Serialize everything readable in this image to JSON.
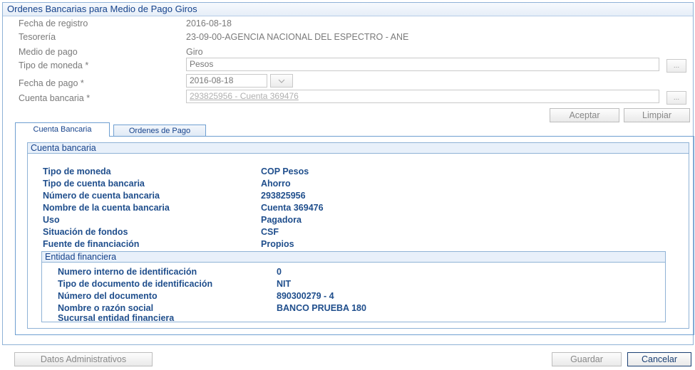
{
  "window": {
    "title": "Ordenes Bancarias para Medio de Pago Giros"
  },
  "header_fields": [
    {
      "label": "Fecha de registro",
      "value": "2016-08-18"
    },
    {
      "label": "Tesorería",
      "value": "23-09-00-AGENCIA NACIONAL DEL ESPECTRO - ANE"
    },
    {
      "label": "Medio de pago",
      "value": "Giro"
    }
  ],
  "form": {
    "tipo_moneda": {
      "label": "Tipo de moneda *",
      "value": "Pesos",
      "button": "..."
    },
    "fecha_pago": {
      "label": "Fecha de pago *",
      "value": "2016-08-18"
    },
    "cuenta_bancaria": {
      "label": "Cuenta bancaria *",
      "value": "293825956 - Cuenta 369476",
      "button": "..."
    }
  },
  "actions": {
    "aceptar": "Aceptar",
    "limpiar": "Limpiar"
  },
  "tabs": [
    {
      "label": "Cuenta Bancaria",
      "active": true
    },
    {
      "label": "Ordenes de Pago",
      "active": false
    }
  ],
  "cuenta_section": {
    "title": "Cuenta bancaria",
    "rows": [
      {
        "label": "Tipo de moneda",
        "value": "COP Pesos"
      },
      {
        "label": "Tipo de cuenta bancaria",
        "value": "Ahorro"
      },
      {
        "label": "Número de cuenta bancaria",
        "value": "293825956"
      },
      {
        "label": "Nombre de la cuenta bancaria",
        "value": "Cuenta 369476"
      },
      {
        "label": "Uso",
        "value": "Pagadora"
      },
      {
        "label": "Situación de fondos",
        "value": "CSF"
      },
      {
        "label": "Fuente de financiación",
        "value": "Propios"
      }
    ]
  },
  "entidad_section": {
    "title": "Entidad financiera",
    "rows": [
      {
        "label": "Numero interno de identificación",
        "value": "0"
      },
      {
        "label": "Tipo de documento de identificación",
        "value": "NIT"
      },
      {
        "label": "Número del documento",
        "value": "890300279 - 4"
      },
      {
        "label": "Nombre o razón social",
        "value": "BANCO PRUEBA 180"
      },
      {
        "label": "Sucursal entidad financiera",
        "value": ""
      }
    ]
  },
  "footer": {
    "datos_admin": "Datos Administrativos",
    "guardar": "Guardar",
    "cancelar": "Cancelar"
  },
  "colors": {
    "accent": "#15428b",
    "border": "#8fb2d6",
    "data_text": "#1f4e8c"
  }
}
